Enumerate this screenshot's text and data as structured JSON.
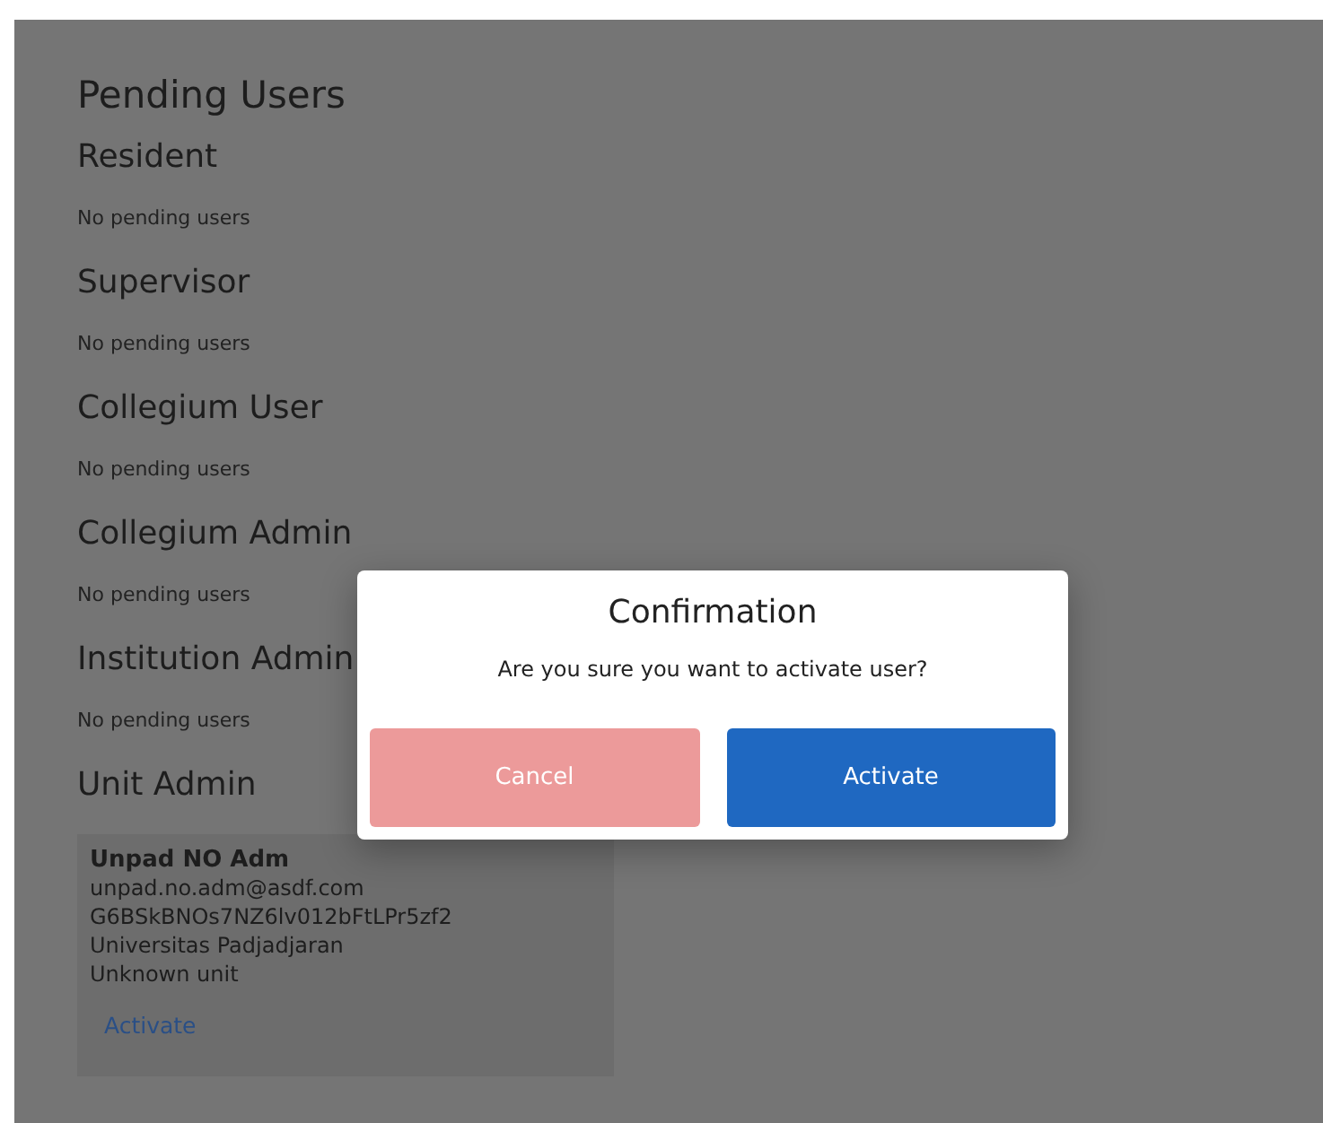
{
  "title": "Pending Users",
  "sections": [
    {
      "heading": "Resident",
      "empty_text": "No pending users"
    },
    {
      "heading": "Supervisor",
      "empty_text": "No pending users"
    },
    {
      "heading": "Collegium User",
      "empty_text": "No pending users"
    },
    {
      "heading": "Collegium Admin",
      "empty_text": "No pending users"
    },
    {
      "heading": "Institution Admin",
      "empty_text": "No pending users"
    },
    {
      "heading": "Unit Admin",
      "users": [
        {
          "name": "Unpad NO Adm",
          "email": "unpad.no.adm@asdf.com",
          "code": "G6BSkBNOs7NZ6lv012bFtLPr5zf2",
          "institution": "Universitas Padjadjaran",
          "unit": "Unknown unit",
          "action": "Activate"
        }
      ]
    }
  ],
  "dialog": {
    "title": "Confirmation",
    "message": "Are you sure you want to activate user?",
    "buttons": [
      {
        "label": "Cancel",
        "kind": "cancel"
      },
      {
        "label": "Activate",
        "kind": "confirm"
      }
    ]
  }
}
